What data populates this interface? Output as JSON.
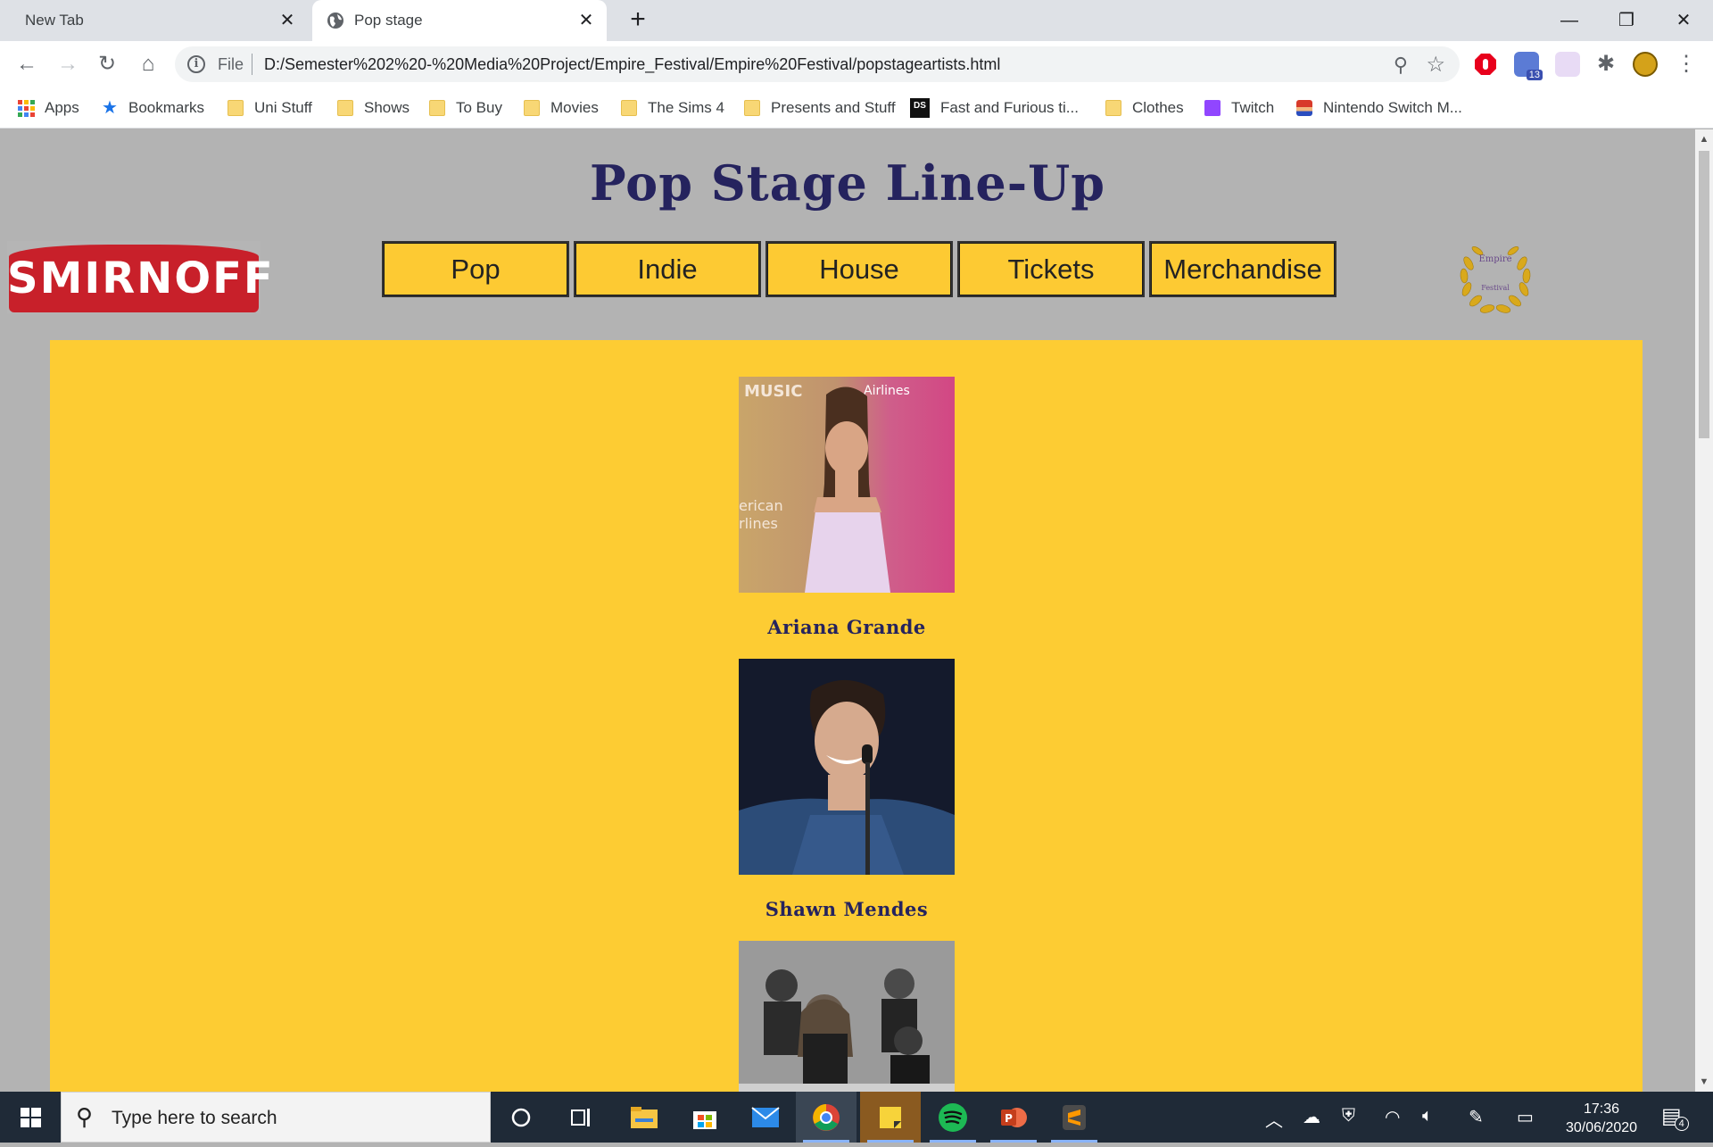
{
  "browser": {
    "tabs": [
      {
        "title": "New Tab"
      },
      {
        "title": "Pop stage"
      }
    ],
    "omnibox": {
      "scheme": "File",
      "url": "D:/Semester%202%20-%20Media%20Project/Empire_Festival/Empire%20Festival/popstageartists.html"
    },
    "bookmarks": [
      {
        "label": "Apps",
        "icon": "apps-grid-icon"
      },
      {
        "label": "Bookmarks",
        "icon": "star-icon"
      },
      {
        "label": "Uni Stuff",
        "icon": "folder-icon"
      },
      {
        "label": "Shows",
        "icon": "folder-icon"
      },
      {
        "label": "To Buy",
        "icon": "folder-icon"
      },
      {
        "label": "Movies",
        "icon": "folder-icon"
      },
      {
        "label": "The Sims 4",
        "icon": "folder-icon"
      },
      {
        "label": "Presents and Stuff",
        "icon": "folder-icon"
      },
      {
        "label": "Fast and Furious ti...",
        "icon": "ds-icon"
      },
      {
        "label": "Clothes",
        "icon": "folder-icon"
      },
      {
        "label": "Twitch",
        "icon": "twitch-icon"
      },
      {
        "label": "Nintendo Switch M...",
        "icon": "mario-icon"
      }
    ],
    "extension_badge": "13"
  },
  "page": {
    "heading": "Pop Stage Line-Up",
    "sponsor": "SMIRNOFF",
    "nav": [
      "Pop",
      "Indie",
      "House",
      "Tickets",
      "Merchandise"
    ],
    "festival_logo": {
      "line1": "Empire",
      "line2": "Festival"
    },
    "artists": [
      {
        "name": "Ariana Grande"
      },
      {
        "name": "Shawn Mendes"
      },
      {
        "name": ""
      }
    ]
  },
  "taskbar": {
    "search_placeholder": "Type here to search",
    "time": "17:36",
    "date": "30/06/2020",
    "notification_count": "4"
  },
  "colors": {
    "page_background": "#b3b3b3",
    "panel_yellow": "#fdcc33",
    "heading_navy": "#25235e",
    "smirnoff_red": "#c8202a"
  }
}
